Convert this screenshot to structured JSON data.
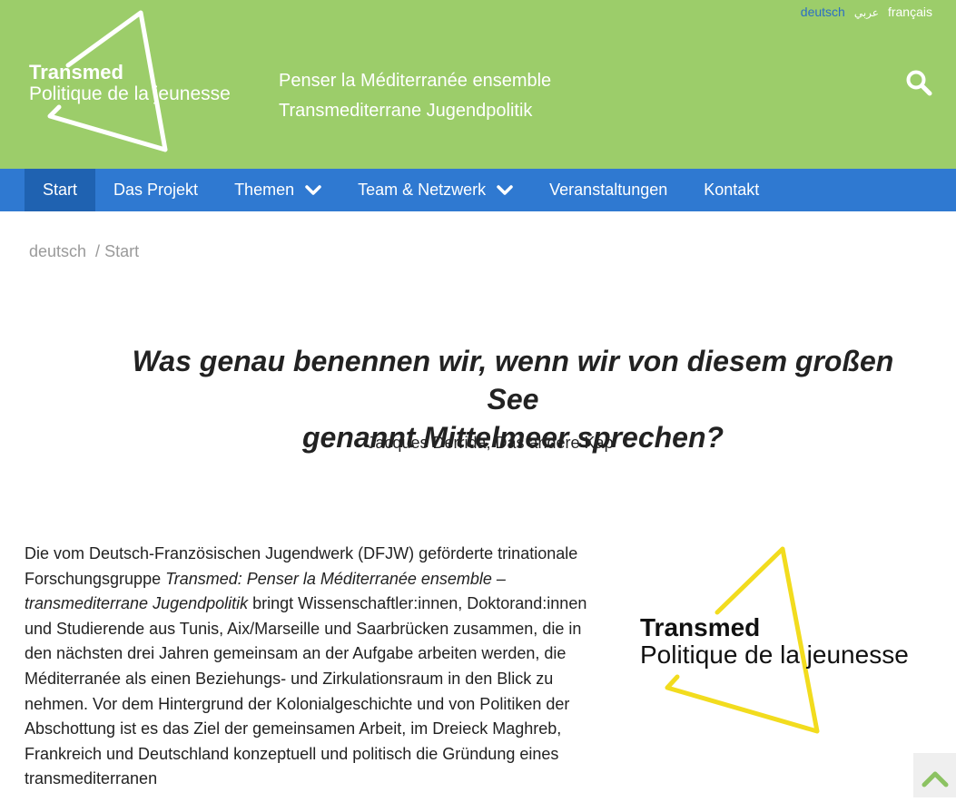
{
  "header": {
    "languages": [
      {
        "label": "deutsch",
        "active": true
      },
      {
        "label": "عربي",
        "active": false
      },
      {
        "label": "français",
        "active": false
      }
    ],
    "logo": {
      "line1": "Transmed",
      "line2": "Politique de la jeunesse"
    },
    "tagline": {
      "line1": "Penser la Méditerranée ensemble",
      "line2": "Transmediterrane Jugendpolitik"
    },
    "search_icon": "search-icon"
  },
  "nav": {
    "items": [
      {
        "label": "Start",
        "active": true,
        "dropdown": false
      },
      {
        "label": "Das Projekt",
        "active": false,
        "dropdown": false
      },
      {
        "label": "Themen",
        "active": false,
        "dropdown": true
      },
      {
        "label": "Team & Netzwerk",
        "active": false,
        "dropdown": true
      },
      {
        "label": "Veranstaltungen",
        "active": false,
        "dropdown": false
      },
      {
        "label": "Kontakt",
        "active": false,
        "dropdown": false
      }
    ]
  },
  "breadcrumb": {
    "home": "deutsch",
    "separator": "/",
    "current": "Start"
  },
  "quote": {
    "line1": "Was genau benennen wir, wenn wir von diesem großen See",
    "line2": "genannt Mittelmeer sprechen?",
    "author": "Jacques Derrida, Das andere Kap"
  },
  "body": {
    "part1": "Die vom Deutsch-Französischen Jugendwerk (DFJW) geförderte trinationale Forschungsgruppe ",
    "italic": "Transmed: Penser la Méditerranée ensemble – transmediterrane Jugendpolitik",
    "part2": " bringt Wissenschaftler:innen, Doktorand:innen und Studierende aus Tunis, Aix/Marseille und Saarbrücken zusammen, die in den nächsten drei Jahren gemeinsam an der Aufgabe arbeiten werden, die Méditerranée als einen Beziehungs- und Zirkulationsraum in den Blick zu nehmen. Vor dem Hintergrund der Kolonialgeschichte und von Politiken der Abschottung ist es das Ziel der gemeinsamen Arbeit, im Dreieck Maghreb, Frankreich und Deutschland konzeptuell und politisch die Gründung eines transmediterranen"
  },
  "side_logo": {
    "line1": "Transmed",
    "line2": "Politique de la jeunesse"
  },
  "colors": {
    "header_bg": "#9ccd6a",
    "nav_bg": "#2f79d1",
    "nav_active": "#1f62b1",
    "accent_yellow": "#f2dc1e",
    "lang_active": "#2b6fc4"
  }
}
